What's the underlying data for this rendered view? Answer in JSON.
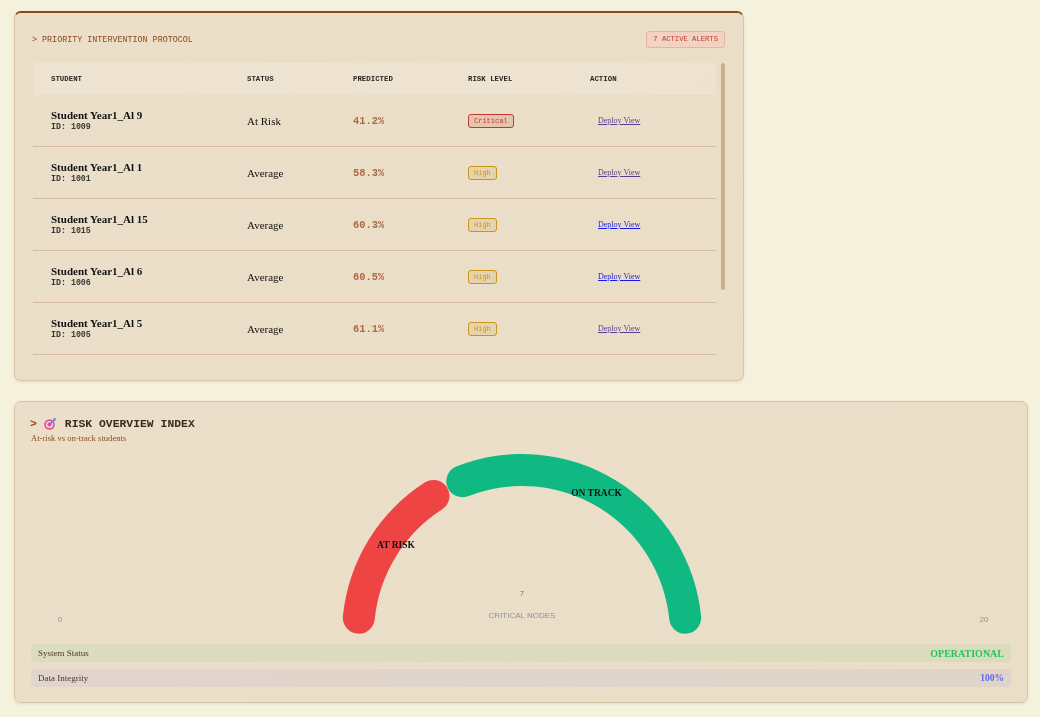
{
  "intervention_panel": {
    "title": "> PRIORITY INTERVENTION PROTOCOL",
    "alert_badge": "7 ACTIVE ALERTS",
    "table": {
      "columns": [
        "STUDENT",
        "STATUS",
        "PREDICTED",
        "RISK LEVEL",
        "ACTION"
      ],
      "rows": [
        {
          "name": "Student Year1_Al 9",
          "id": "ID: 1009",
          "status": "At Risk",
          "predicted": "41.2%",
          "risk": {
            "label": "Critical",
            "color": "#c0392b"
          },
          "action": {
            "label": "Deploy View",
            "visited": true
          }
        },
        {
          "name": "Student Year1_Al 1",
          "id": "ID: 1001",
          "status": "Average",
          "predicted": "58.3%",
          "risk": {
            "label": "High",
            "color": "#c9961a"
          },
          "action": {
            "label": "Deploy View",
            "visited": true
          }
        },
        {
          "name": "Student Year1_Al 15",
          "id": "ID: 1015",
          "status": "Average",
          "predicted": "60.3%",
          "risk": {
            "label": "High",
            "color": "#c9961a"
          },
          "action": {
            "label": "Deploy View",
            "visited": false
          }
        },
        {
          "name": "Student Year1_Al 6",
          "id": "ID: 1006",
          "status": "Average",
          "predicted": "60.5%",
          "risk": {
            "label": "High",
            "color": "#c9961a"
          },
          "action": {
            "label": "Deploy View",
            "visited": false
          }
        },
        {
          "name": "Student Year1_Al 5",
          "id": "ID: 1005",
          "status": "Average",
          "predicted": "61.1%",
          "risk": {
            "label": "High",
            "color": "#c9961a"
          },
          "action": {
            "label": "Deploy View",
            "visited": true
          }
        }
      ]
    }
  },
  "risk_overview": {
    "prompt": ">",
    "title": "RISK OVERVIEW INDEX",
    "subtitle": "At-risk vs on-track students",
    "center_value": "7",
    "center_label": "CRITICAL NODES",
    "scale_labels": [
      "0",
      "20"
    ],
    "chart_data": {
      "type": "donut",
      "categories": [
        "AT RISK",
        "ON TRACK"
      ],
      "values": [
        35,
        65
      ]
    },
    "status_rows": [
      {
        "label": "System Status",
        "value": "OPERATIONAL",
        "color": "#22c55e",
        "kind": "status"
      },
      {
        "label": "Data Integrity",
        "value": "100%",
        "color": "#6366f1",
        "kind": "percent"
      }
    ]
  }
}
